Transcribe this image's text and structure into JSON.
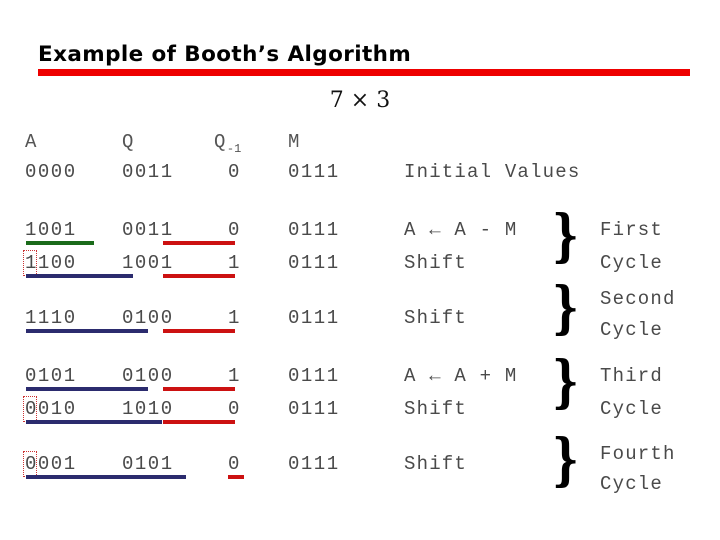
{
  "title": "Example of Booth’s Algorithm",
  "expression": "7 × 3",
  "colors": {
    "title_rule": "#ee0000",
    "green_rule": "#1a6b1a",
    "navy_rule": "#2b2b6e",
    "red_rule": "#cc1111",
    "dotted_box": "#cc3333",
    "text": "#4a4a4a"
  },
  "headers": {
    "a": "A",
    "q": "Q",
    "q_minus_1": "Q",
    "q_minus_1_sub": "-1",
    "m": "M"
  },
  "rows": [
    {
      "a": "0000",
      "q": "0011",
      "q1": "0",
      "m": "0111",
      "op": "Initial Values"
    },
    {
      "a": "1001",
      "q": "0011",
      "q1": "0",
      "m": "0111",
      "op": "A ← A - M"
    },
    {
      "a": "1100",
      "q": "1001",
      "q1": "1",
      "m": "0111",
      "op": "Shift"
    },
    {
      "a": "1110",
      "q": "0100",
      "q1": "1",
      "m": "0111",
      "op": "Shift"
    },
    {
      "a": "0101",
      "q": "0100",
      "q1": "1",
      "m": "0111",
      "op": "A ← A + M"
    },
    {
      "a": "0010",
      "q": "1010",
      "q1": "0",
      "m": "0111",
      "op": "Shift"
    },
    {
      "a": "0001",
      "q": "0101",
      "q1": "0",
      "m": "0111",
      "op": "Shift"
    }
  ],
  "cycles": [
    {
      "name": "First",
      "suffix": "Cycle"
    },
    {
      "name": "Second",
      "suffix": "Cycle"
    },
    {
      "name": "Third",
      "suffix": "Cycle"
    },
    {
      "name": "Fourth",
      "suffix": "Cycle"
    }
  ],
  "brace_glyph": "}"
}
